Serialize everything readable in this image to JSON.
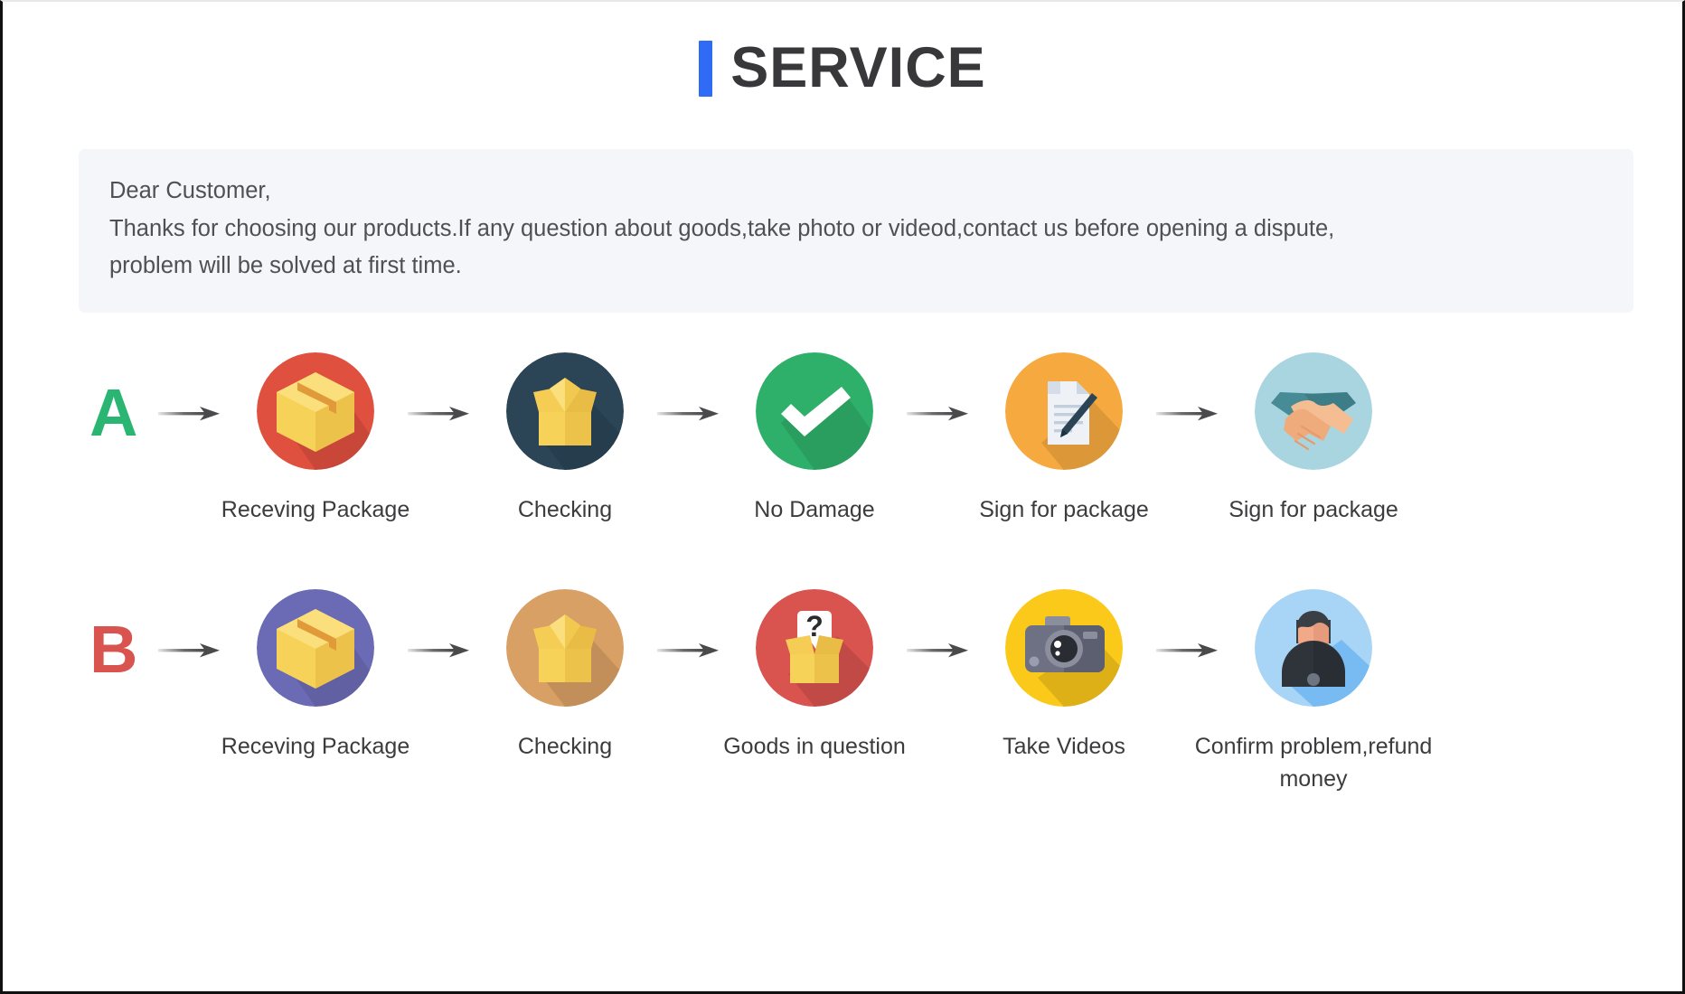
{
  "header": {
    "accent_color": "#2f6bf5",
    "title": "SERVICE"
  },
  "notice": {
    "line1": "Dear Customer,",
    "line2": "Thanks for choosing our products.If any question about goods,take photo or videod,contact us before opening a dispute,",
    "line3": "problem will be solved at first time.",
    "background_color": "#f4f6fa"
  },
  "flows": [
    {
      "letter": "A",
      "letter_color": "#2ab573",
      "steps": [
        {
          "label": "Receving Package",
          "icon": "sealed-box-icon",
          "circle_color": "#e0503f"
        },
        {
          "label": "Checking",
          "icon": "open-box-icon",
          "circle_color": "#2b4557"
        },
        {
          "label": "No Damage",
          "icon": "checkmark-icon",
          "circle_color": "#2fb06a"
        },
        {
          "label": "Sign for package",
          "icon": "document-pen-icon",
          "circle_color": "#f5a93f"
        },
        {
          "label": "Sign for package",
          "icon": "handshake-icon",
          "circle_color": "#a8d5df"
        }
      ]
    },
    {
      "letter": "B",
      "letter_color": "#d9534f",
      "steps": [
        {
          "label": "Receving Package",
          "icon": "sealed-box-icon",
          "circle_color": "#6b6bb5"
        },
        {
          "label": "Checking",
          "icon": "open-box-icon",
          "circle_color": "#d9a066"
        },
        {
          "label": "Goods in question",
          "icon": "question-box-icon",
          "circle_color": "#d9534f"
        },
        {
          "label": "Take Videos",
          "icon": "camera-icon",
          "circle_color": "#fbc91a"
        },
        {
          "label": "Confirm problem,refund money",
          "icon": "support-person-icon",
          "circle_color": "#a8d5f5"
        }
      ]
    }
  ],
  "arrow": {
    "name": "arrow-right-icon",
    "color": "#5a5a5c"
  }
}
